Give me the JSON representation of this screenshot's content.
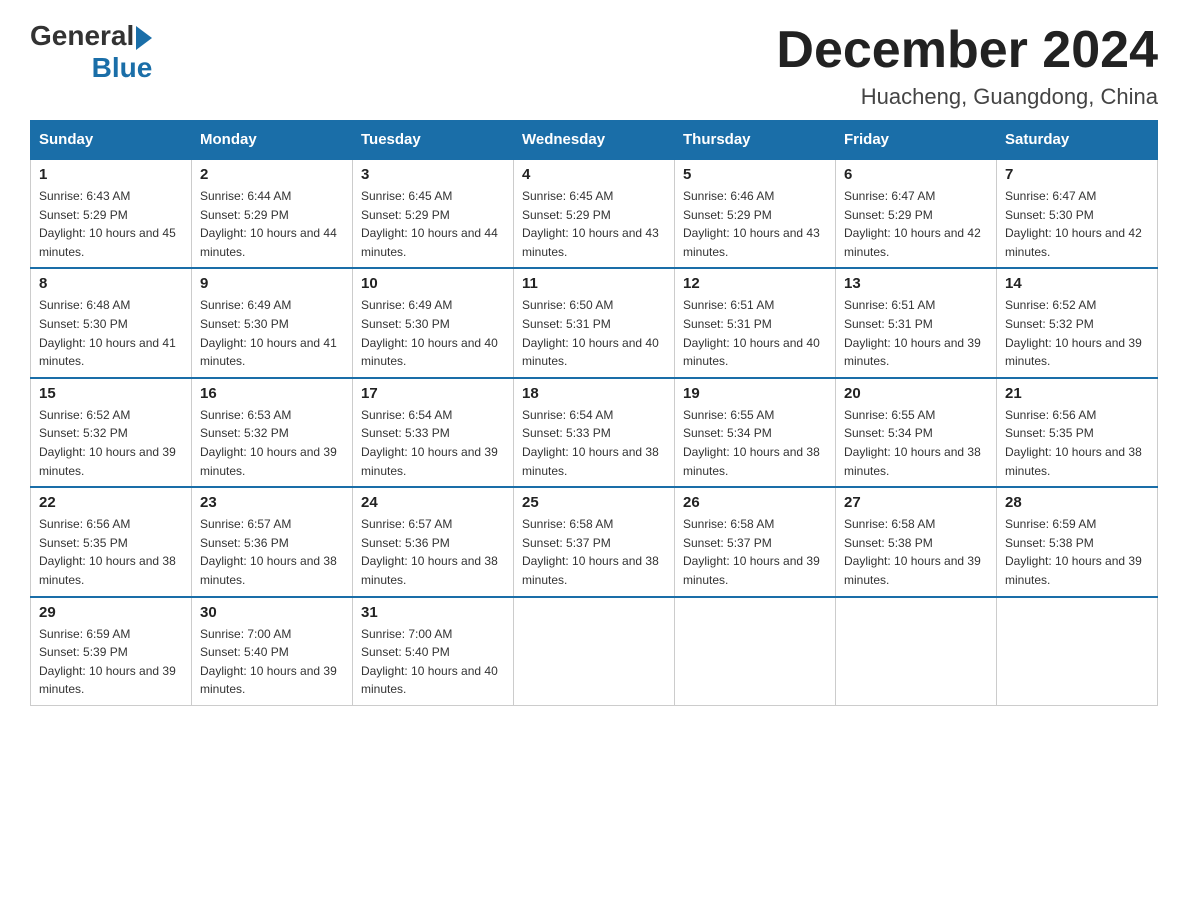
{
  "header": {
    "logo_general": "General",
    "logo_blue": "Blue",
    "month_title": "December 2024",
    "location": "Huacheng, Guangdong, China"
  },
  "days_of_week": [
    "Sunday",
    "Monday",
    "Tuesday",
    "Wednesday",
    "Thursday",
    "Friday",
    "Saturday"
  ],
  "weeks": [
    [
      {
        "day": "1",
        "sunrise": "6:43 AM",
        "sunset": "5:29 PM",
        "daylight": "10 hours and 45 minutes."
      },
      {
        "day": "2",
        "sunrise": "6:44 AM",
        "sunset": "5:29 PM",
        "daylight": "10 hours and 44 minutes."
      },
      {
        "day": "3",
        "sunrise": "6:45 AM",
        "sunset": "5:29 PM",
        "daylight": "10 hours and 44 minutes."
      },
      {
        "day": "4",
        "sunrise": "6:45 AM",
        "sunset": "5:29 PM",
        "daylight": "10 hours and 43 minutes."
      },
      {
        "day": "5",
        "sunrise": "6:46 AM",
        "sunset": "5:29 PM",
        "daylight": "10 hours and 43 minutes."
      },
      {
        "day": "6",
        "sunrise": "6:47 AM",
        "sunset": "5:29 PM",
        "daylight": "10 hours and 42 minutes."
      },
      {
        "day": "7",
        "sunrise": "6:47 AM",
        "sunset": "5:30 PM",
        "daylight": "10 hours and 42 minutes."
      }
    ],
    [
      {
        "day": "8",
        "sunrise": "6:48 AM",
        "sunset": "5:30 PM",
        "daylight": "10 hours and 41 minutes."
      },
      {
        "day": "9",
        "sunrise": "6:49 AM",
        "sunset": "5:30 PM",
        "daylight": "10 hours and 41 minutes."
      },
      {
        "day": "10",
        "sunrise": "6:49 AM",
        "sunset": "5:30 PM",
        "daylight": "10 hours and 40 minutes."
      },
      {
        "day": "11",
        "sunrise": "6:50 AM",
        "sunset": "5:31 PM",
        "daylight": "10 hours and 40 minutes."
      },
      {
        "day": "12",
        "sunrise": "6:51 AM",
        "sunset": "5:31 PM",
        "daylight": "10 hours and 40 minutes."
      },
      {
        "day": "13",
        "sunrise": "6:51 AM",
        "sunset": "5:31 PM",
        "daylight": "10 hours and 39 minutes."
      },
      {
        "day": "14",
        "sunrise": "6:52 AM",
        "sunset": "5:32 PM",
        "daylight": "10 hours and 39 minutes."
      }
    ],
    [
      {
        "day": "15",
        "sunrise": "6:52 AM",
        "sunset": "5:32 PM",
        "daylight": "10 hours and 39 minutes."
      },
      {
        "day": "16",
        "sunrise": "6:53 AM",
        "sunset": "5:32 PM",
        "daylight": "10 hours and 39 minutes."
      },
      {
        "day": "17",
        "sunrise": "6:54 AM",
        "sunset": "5:33 PM",
        "daylight": "10 hours and 39 minutes."
      },
      {
        "day": "18",
        "sunrise": "6:54 AM",
        "sunset": "5:33 PM",
        "daylight": "10 hours and 38 minutes."
      },
      {
        "day": "19",
        "sunrise": "6:55 AM",
        "sunset": "5:34 PM",
        "daylight": "10 hours and 38 minutes."
      },
      {
        "day": "20",
        "sunrise": "6:55 AM",
        "sunset": "5:34 PM",
        "daylight": "10 hours and 38 minutes."
      },
      {
        "day": "21",
        "sunrise": "6:56 AM",
        "sunset": "5:35 PM",
        "daylight": "10 hours and 38 minutes."
      }
    ],
    [
      {
        "day": "22",
        "sunrise": "6:56 AM",
        "sunset": "5:35 PM",
        "daylight": "10 hours and 38 minutes."
      },
      {
        "day": "23",
        "sunrise": "6:57 AM",
        "sunset": "5:36 PM",
        "daylight": "10 hours and 38 minutes."
      },
      {
        "day": "24",
        "sunrise": "6:57 AM",
        "sunset": "5:36 PM",
        "daylight": "10 hours and 38 minutes."
      },
      {
        "day": "25",
        "sunrise": "6:58 AM",
        "sunset": "5:37 PM",
        "daylight": "10 hours and 38 minutes."
      },
      {
        "day": "26",
        "sunrise": "6:58 AM",
        "sunset": "5:37 PM",
        "daylight": "10 hours and 39 minutes."
      },
      {
        "day": "27",
        "sunrise": "6:58 AM",
        "sunset": "5:38 PM",
        "daylight": "10 hours and 39 minutes."
      },
      {
        "day": "28",
        "sunrise": "6:59 AM",
        "sunset": "5:38 PM",
        "daylight": "10 hours and 39 minutes."
      }
    ],
    [
      {
        "day": "29",
        "sunrise": "6:59 AM",
        "sunset": "5:39 PM",
        "daylight": "10 hours and 39 minutes."
      },
      {
        "day": "30",
        "sunrise": "7:00 AM",
        "sunset": "5:40 PM",
        "daylight": "10 hours and 39 minutes."
      },
      {
        "day": "31",
        "sunrise": "7:00 AM",
        "sunset": "5:40 PM",
        "daylight": "10 hours and 40 minutes."
      },
      null,
      null,
      null,
      null
    ]
  ],
  "labels": {
    "sunrise": "Sunrise:",
    "sunset": "Sunset:",
    "daylight": "Daylight:"
  }
}
